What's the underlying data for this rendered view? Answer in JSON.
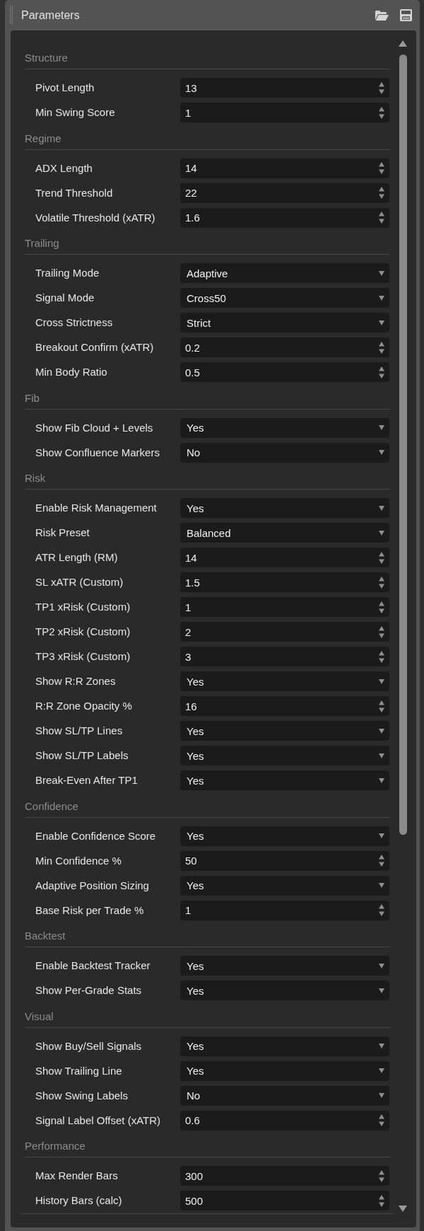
{
  "panel": {
    "title": "Parameters"
  },
  "sections": [
    {
      "title": "Structure",
      "fields": [
        {
          "label": "Pivot Length",
          "kind": "number",
          "value": "13"
        },
        {
          "label": "Min Swing Score",
          "kind": "number",
          "value": "1"
        }
      ]
    },
    {
      "title": "Regime",
      "fields": [
        {
          "label": "ADX Length",
          "kind": "number",
          "value": "14"
        },
        {
          "label": "Trend Threshold",
          "kind": "number",
          "value": "22"
        },
        {
          "label": "Volatile Threshold (xATR)",
          "kind": "number",
          "value": "1.6"
        }
      ]
    },
    {
      "title": "Trailing",
      "fields": [
        {
          "label": "Trailing Mode",
          "kind": "select",
          "value": "Adaptive"
        },
        {
          "label": "Signal Mode",
          "kind": "select",
          "value": "Cross50"
        },
        {
          "label": "Cross Strictness",
          "kind": "select",
          "value": "Strict"
        },
        {
          "label": "Breakout Confirm (xATR)",
          "kind": "number",
          "value": "0.2"
        },
        {
          "label": "Min Body Ratio",
          "kind": "number",
          "value": "0.5"
        }
      ]
    },
    {
      "title": "Fib",
      "fields": [
        {
          "label": "Show Fib Cloud + Levels",
          "kind": "select",
          "value": "Yes"
        },
        {
          "label": "Show Confluence Markers",
          "kind": "select",
          "value": "No"
        }
      ]
    },
    {
      "title": "Risk",
      "fields": [
        {
          "label": "Enable Risk Management",
          "kind": "select",
          "value": "Yes"
        },
        {
          "label": "Risk Preset",
          "kind": "select",
          "value": "Balanced"
        },
        {
          "label": "ATR Length (RM)",
          "kind": "number",
          "value": "14"
        },
        {
          "label": "SL xATR (Custom)",
          "kind": "number",
          "value": "1.5"
        },
        {
          "label": "TP1 xRisk (Custom)",
          "kind": "number",
          "value": "1"
        },
        {
          "label": "TP2 xRisk (Custom)",
          "kind": "number",
          "value": "2"
        },
        {
          "label": "TP3 xRisk (Custom)",
          "kind": "number",
          "value": "3"
        },
        {
          "label": "Show R:R Zones",
          "kind": "select",
          "value": "Yes"
        },
        {
          "label": "R:R Zone Opacity %",
          "kind": "number",
          "value": "16"
        },
        {
          "label": "Show SL/TP Lines",
          "kind": "select",
          "value": "Yes"
        },
        {
          "label": "Show SL/TP Labels",
          "kind": "select",
          "value": "Yes"
        },
        {
          "label": "Break-Even After TP1",
          "kind": "select",
          "value": "Yes"
        }
      ]
    },
    {
      "title": "Confidence",
      "fields": [
        {
          "label": "Enable Confidence Score",
          "kind": "select",
          "value": "Yes"
        },
        {
          "label": "Min Confidence %",
          "kind": "number",
          "value": "50"
        },
        {
          "label": "Adaptive Position Sizing",
          "kind": "select",
          "value": "Yes"
        },
        {
          "label": "Base Risk per Trade %",
          "kind": "number",
          "value": "1"
        }
      ]
    },
    {
      "title": "Backtest",
      "fields": [
        {
          "label": "Enable Backtest Tracker",
          "kind": "select",
          "value": "Yes"
        },
        {
          "label": "Show Per-Grade Stats",
          "kind": "select",
          "value": "Yes"
        }
      ]
    },
    {
      "title": "Visual",
      "fields": [
        {
          "label": "Show Buy/Sell Signals",
          "kind": "select",
          "value": "Yes"
        },
        {
          "label": "Show Trailing Line",
          "kind": "select",
          "value": "Yes"
        },
        {
          "label": "Show Swing Labels",
          "kind": "select",
          "value": "No"
        },
        {
          "label": "Signal Label Offset (xATR)",
          "kind": "number",
          "value": "0.6"
        }
      ]
    },
    {
      "title": "Performance",
      "fields": [
        {
          "label": "Max Render Bars",
          "kind": "number",
          "value": "300"
        },
        {
          "label": "History Bars (calc)",
          "kind": "number",
          "value": "500"
        }
      ]
    }
  ]
}
